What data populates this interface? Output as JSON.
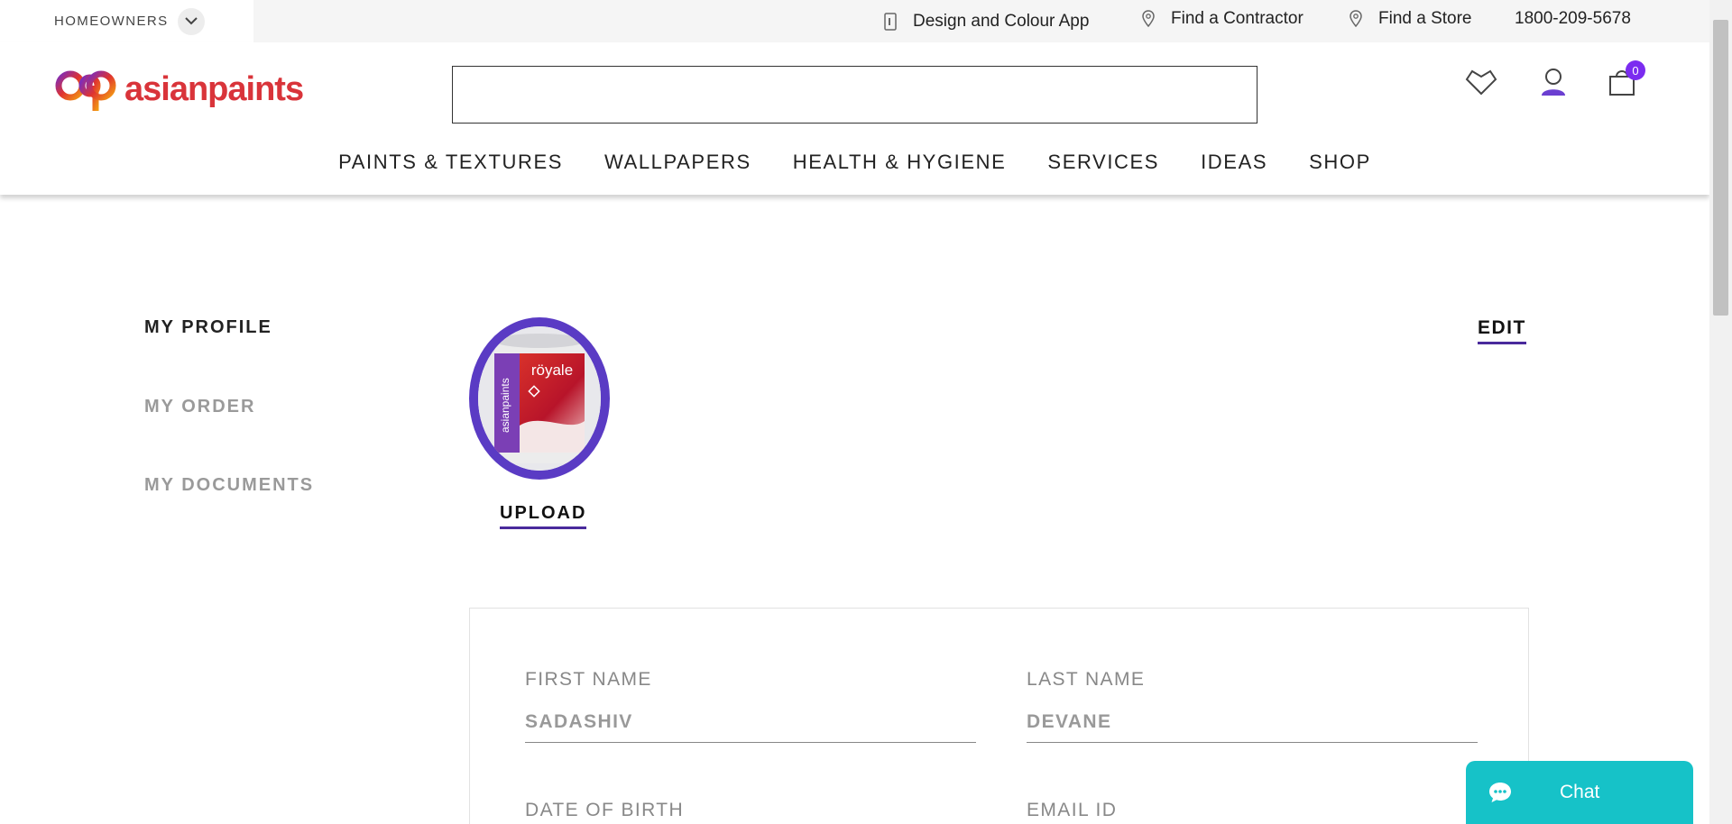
{
  "topbar": {
    "audience_label": "HOMEOWNERS",
    "links": [
      {
        "label": "Design and Colour App",
        "icon": "phone-icon"
      },
      {
        "label": "Find a Contractor",
        "icon": "location-pin-icon"
      },
      {
        "label": "Find a Store",
        "icon": "location-pin-icon"
      }
    ],
    "phone": "1800-209-5678"
  },
  "header": {
    "logo_text": "asianpaints",
    "search": {
      "value": "",
      "placeholder": ""
    },
    "cart_count": "0"
  },
  "nav": {
    "items": [
      "PAINTS & TEXTURES",
      "WALLPAPERS",
      "HEALTH & HYGIENE",
      "SERVICES",
      "IDEAS",
      "SHOP"
    ]
  },
  "sidebar": {
    "items": [
      "MY PROFILE",
      "MY ORDER",
      "MY DOCUMENTS"
    ],
    "active": "MY PROFILE"
  },
  "profile": {
    "avatar_product": "röyale",
    "avatar_brand": "asianpaints",
    "upload_label": "UPLOAD",
    "edit_label": "EDIT"
  },
  "form": {
    "first_name_label": "FIRST NAME",
    "first_name_value": "SADASHIV",
    "last_name_label": "LAST NAME",
    "last_name_value": "DEVANE",
    "dob_label": "DATE OF BIRTH",
    "email_label": "EMAIL ID"
  },
  "chat": {
    "label": "Chat"
  },
  "colors": {
    "accent": "#5a3bc4",
    "brand_red": "#d9343a",
    "chat": "#16c2c8",
    "badge": "#7b2cf0"
  }
}
